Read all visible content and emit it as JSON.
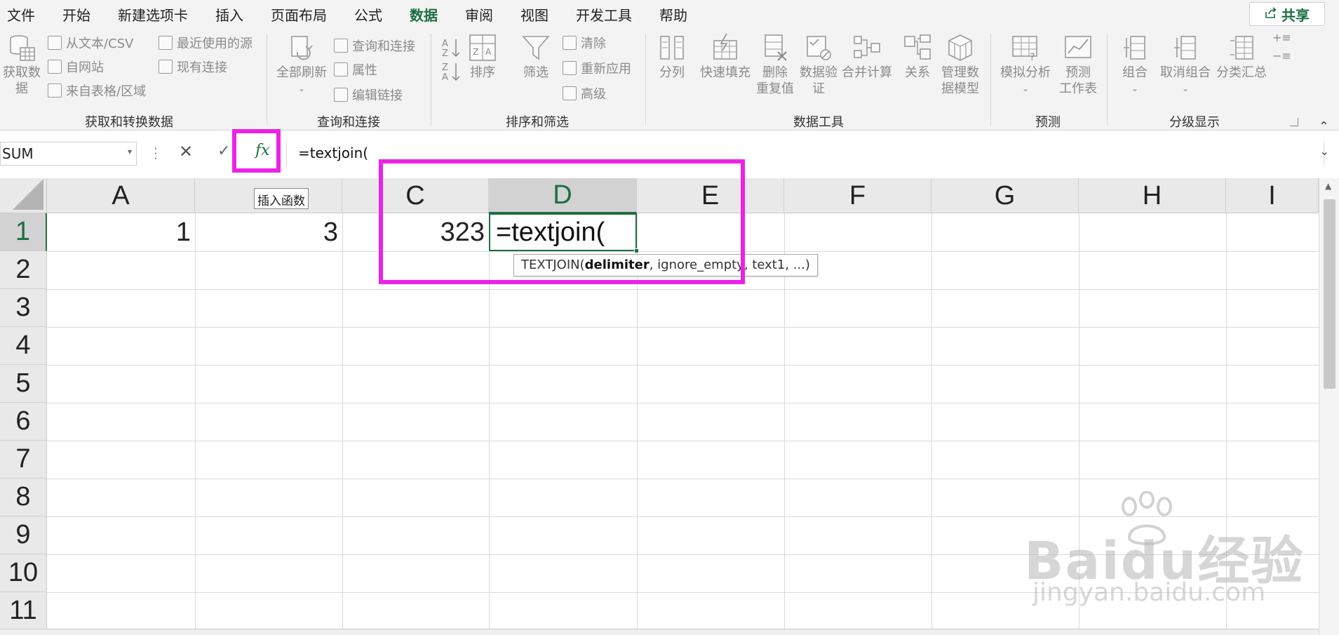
{
  "menu": {
    "tabs": [
      {
        "label": "文件",
        "active": false
      },
      {
        "label": "开始",
        "active": false
      },
      {
        "label": "新建选项卡",
        "active": false
      },
      {
        "label": "插入",
        "active": false
      },
      {
        "label": "页面布局",
        "active": false
      },
      {
        "label": "公式",
        "active": false
      },
      {
        "label": "数据",
        "active": true
      },
      {
        "label": "审阅",
        "active": false
      },
      {
        "label": "视图",
        "active": false
      },
      {
        "label": "开发工具",
        "active": false
      },
      {
        "label": "帮助",
        "active": false
      }
    ],
    "share": "共享"
  },
  "ribbon": {
    "get_data": {
      "big_line1": "获取数",
      "big_line2": "据",
      "items": [
        "从文本/CSV",
        "自网站",
        "来自表格/区域"
      ],
      "items2": [
        "最近使用的源",
        "现有连接"
      ],
      "label": "获取和转换数据"
    },
    "queries": {
      "refresh": "全部刷新",
      "items": [
        "查询和连接",
        "属性",
        "编辑链接"
      ],
      "label": "查询和连接"
    },
    "sort": {
      "sort_label": "排序",
      "filter": "筛选",
      "items": [
        "清除",
        "重新应用",
        "高级"
      ],
      "label": "排序和筛选"
    },
    "tools": {
      "split": "分列",
      "flash": "快速填充",
      "dup_line1": "删除",
      "dup_line2": "重复值",
      "valid_line1": "数据验",
      "valid_line2": "证",
      "consolidate": "合并计算",
      "relations": "关系",
      "model_line1": "管理数",
      "model_line2": "据模型",
      "label": "数据工具"
    },
    "forecast": {
      "whatif": "模拟分析",
      "sheet_line1": "预测",
      "sheet_line2": "工作表",
      "label": "预测"
    },
    "outline": {
      "group": "组合",
      "ungroup": "取消组合",
      "subtotal": "分类汇总",
      "label": "分级显示"
    }
  },
  "formula_bar": {
    "name_box": "SUM",
    "formula": "=textjoin(",
    "fx": "fx",
    "fx_tooltip": "插入函数"
  },
  "grid": {
    "columns": [
      {
        "letter": "A",
        "selected": false
      },
      {
        "letter": "",
        "selected": false
      },
      {
        "letter": "C",
        "selected": false
      },
      {
        "letter": "D",
        "selected": true
      },
      {
        "letter": "E",
        "selected": false
      },
      {
        "letter": "F",
        "selected": false
      },
      {
        "letter": "G",
        "selected": false
      },
      {
        "letter": "H",
        "selected": false
      },
      {
        "letter": "I",
        "selected": false
      }
    ],
    "rows": [
      "1",
      "2",
      "3",
      "4",
      "5",
      "6",
      "7",
      "8",
      "9",
      "10",
      "11"
    ],
    "cells": {
      "A1": "1",
      "B1": "3",
      "C1": "323"
    },
    "active_cell_text": "=textjoin(",
    "function_hint": {
      "prefix": "TEXTJOIN(",
      "bold": "delimiter",
      "rest": ", ignore_empty, text1, ...)"
    }
  },
  "watermark": {
    "line1": "Baidu经验",
    "line2": "jingyan.baidu.com"
  },
  "colors": {
    "accent": "#1e6e42",
    "highlight": "#ec22e6"
  }
}
